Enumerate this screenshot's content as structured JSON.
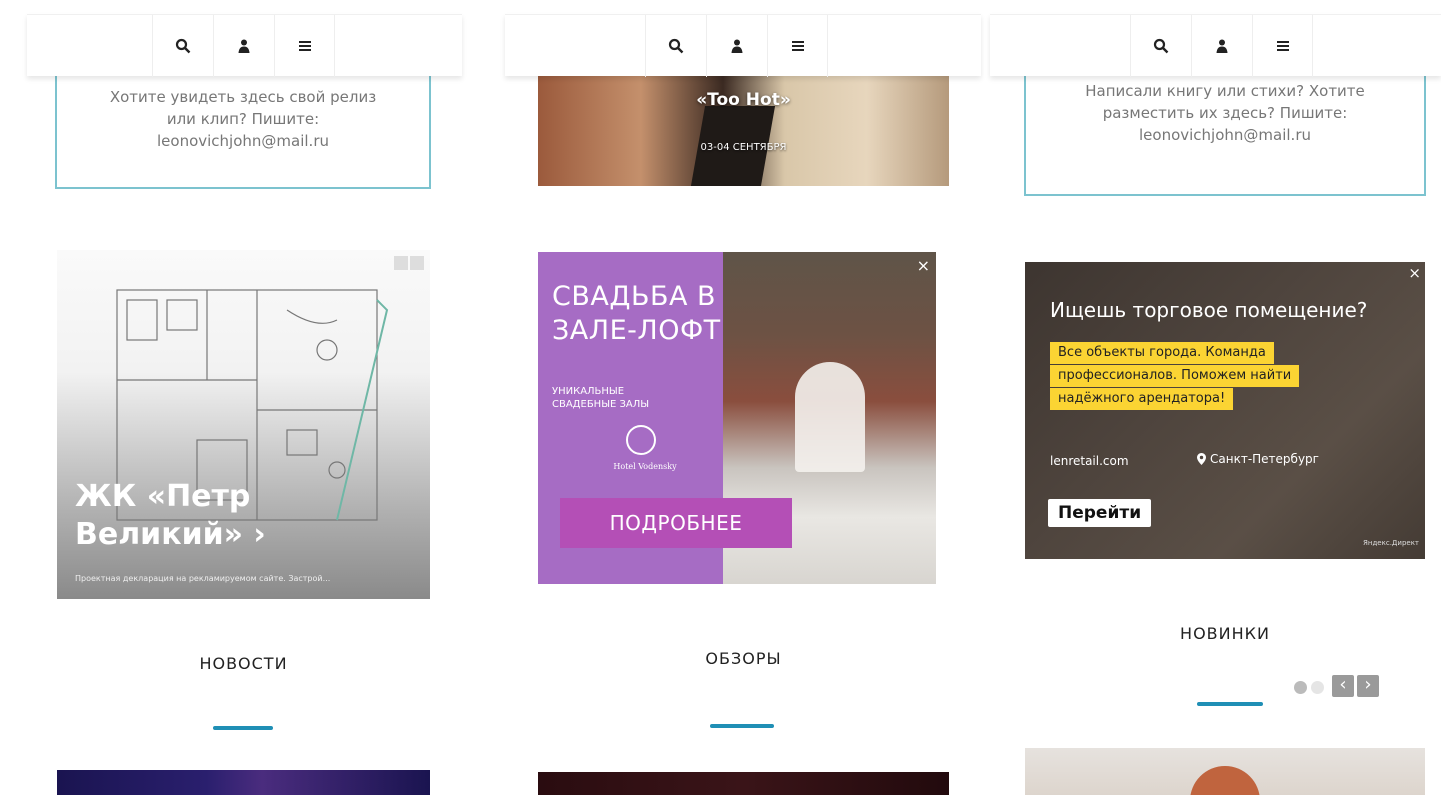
{
  "nav": {
    "icons": [
      "search-icon",
      "user-icon",
      "menu-icon"
    ]
  },
  "col1": {
    "promo": {
      "line1": "Хотите увидеть здесь свой релиз",
      "line2": "или клип? Пишите:",
      "line3": "leonovichjohn@mail.ru"
    },
    "ad": {
      "title_line1": "ЖК «Петр",
      "title_line2": "Великий» ›",
      "disclaimer": "Проектная декларация на рекламируемом сайте. Застрой..."
    },
    "section_title": "НОВОСТИ"
  },
  "col2": {
    "event": {
      "title": "«Too Hot»",
      "date": "03-04 СЕНТЯБРЯ"
    },
    "ad": {
      "headline_line1": "СВАДЬБА В",
      "headline_line2": "ЗАЛЕ-ЛОФТ",
      "sub_line1": "УНИКАЛЬНЫЕ",
      "sub_line2": "СВАДЕБНЫЕ ЗАЛЫ",
      "brand": "Hotel Vodensky",
      "cta": "ПОДРОБНЕЕ",
      "close": "×"
    },
    "section_title": "ОБЗОРЫ"
  },
  "col3": {
    "promo": {
      "line1": "Написали книгу или стихи? Хотите",
      "line2": "разместить их здесь? Пишите:",
      "line3": "leonovichjohn@mail.ru"
    },
    "ad": {
      "headline": "Ищешь торговое помещение?",
      "body_line1": "Все объекты города. Команда",
      "body_line2": "профессионалов. Поможем найти",
      "body_line3": "надёжного арендатора!",
      "domain": "lenretail.com",
      "location": "Санкт-Петербург",
      "cta": "Перейти",
      "network": "Яндекс.Директ",
      "close": "×"
    },
    "section_title": "НОВИНКИ",
    "carousel": {
      "prev": "‹",
      "next": "›"
    }
  },
  "colors": {
    "accent": "#1f8fb5",
    "promo_border": "#7cc3cf",
    "wedding_purple": "#a66cc4",
    "yellow_highlight": "#fbd433"
  }
}
